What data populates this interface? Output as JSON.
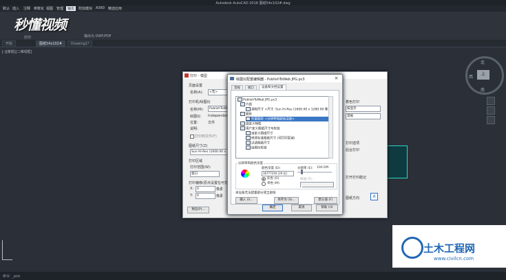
{
  "app": {
    "title": "Autodesk AutoCAD 2018   图纸54x102#.dwg",
    "menus": [
      "默认",
      "插入",
      "注释",
      "参数化",
      "视图",
      "管理",
      "输出",
      "附加模块",
      "A360",
      "精选应用"
    ],
    "active_menu": "输出",
    "ribbon_print_label": "打印",
    "ribbon_dwf_label": "输出为 DWF/PDF",
    "logo_text": "秒懂视频"
  },
  "doc_tabs": [
    "开始",
    "图纸54x102#",
    "Drawing1*"
  ],
  "active_tab": "图纸54x102#",
  "viewport": {
    "label": "[-][俯视][二维线框]",
    "compass": {
      "north": "北",
      "south": "南",
      "west": "西",
      "face": "上"
    }
  },
  "page_setup_dialog": {
    "title": "打印 - 模型",
    "section_page_setup": "页面设置",
    "name_label": "名称(A):",
    "name_value": "<无>",
    "printer_section": "打印机/绘图仪",
    "printer_name_label": "名称(M):",
    "printer_name_value": "PublishToWeb JPG.pc3",
    "plotter_label": "绘图仪:",
    "plotter_value": "Independent",
    "location_label": "位置:",
    "location_value": "文件",
    "desc_label": "说明:",
    "plot_to_file": "打印到文件(F)",
    "paper_size_section": "图纸尺寸(Z)",
    "paper_size_value": "Sun Hi-Res (1600.00 x",
    "plot_area_section": "打印区域",
    "plot_range_label": "打印范围(W):",
    "plot_range_value": "窗口",
    "plot_offset_section": "打印偏移(原点设置在可打印区域)",
    "x_value": "0",
    "y_value": "0",
    "unit": "像素",
    "preview_button": "预览(P)...",
    "right_labels": [
      "着色打印",
      "质量",
      "打印选项",
      "后台打印",
      "打开打印戳记",
      "图纸方向"
    ],
    "right_value_1": "按显示",
    "right_value_2": "常规"
  },
  "plotter_editor": {
    "title": "绘图仪配置编辑器 - PublishToWeb JPG.pc3",
    "tabs": [
      "常规",
      "端口",
      "设备和文档设置"
    ],
    "active_tab": "设备和文档设置",
    "tree_items": [
      "PublishToWeb JPG.pc3",
      "介质",
      "源和尺寸 <尺寸: Sun Hi-Res (1600.00 x 1280.00 像",
      "图形",
      "矢量图形 <分辨率和颜色深度>",
      "自定义特性",
      "用户定义图纸尺寸与校准",
      "自定义图纸尺寸",
      "修改标准图纸尺寸 (可打印区域)",
      "过滤图纸尺寸",
      "绘图仪校准"
    ],
    "selected_tree_index": 4,
    "resolution_group": "分辨率和颜色深度",
    "color_depth_label": "颜色深度 (D):",
    "color_depth_value": "16777216 (24 位)",
    "resolution_label": "分辨率 (E):",
    "resolution_value": "100 DPI",
    "color_radio": "彩色 (O)",
    "mono_radio": "单色 (M)",
    "dither_label": "抖动 (T):",
    "not_all_settings": "本设备无法配置部分或全部值",
    "import_button": "输入 (I)...",
    "save_as_button": "另存为 (S)...",
    "defaults_button": "默认值 (F)",
    "ok_button": "确定",
    "cancel_button": "取消",
    "help_button": "帮助 (H)"
  },
  "command_line": {
    "text": "命令: _plot"
  },
  "watermark": {
    "title": "土木工程网",
    "url": "www.civilcn.com"
  },
  "colors": {
    "background": "#2b3038",
    "selection": "#3a77c4",
    "watermark_blue": "#2067b5"
  }
}
